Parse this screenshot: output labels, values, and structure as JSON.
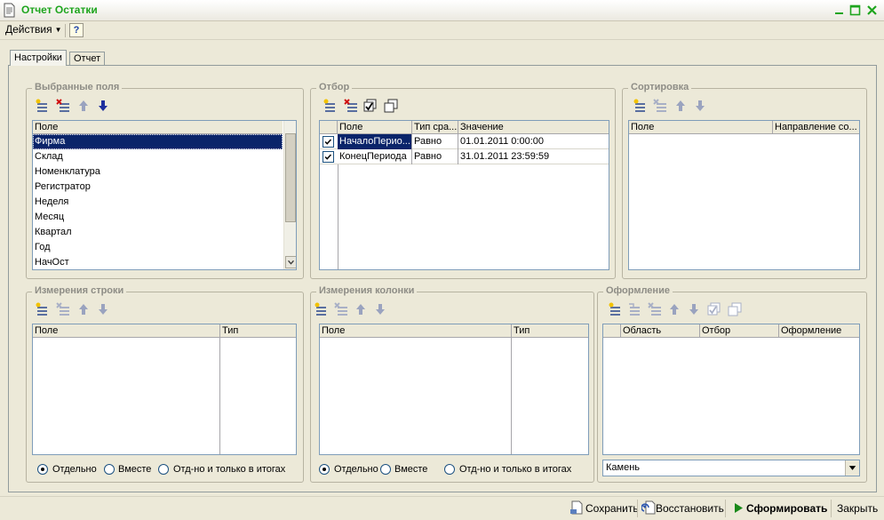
{
  "window": {
    "title": "Отчет  Остатки"
  },
  "menu": {
    "actions_label": "Действия",
    "help_label": "?"
  },
  "tabs": [
    {
      "label": "Настройки"
    },
    {
      "label": "Отчет"
    }
  ],
  "selected_fields": {
    "title": "Выбранные поля",
    "column": "Поле",
    "rows": [
      "Фирма",
      "Склад",
      "Номенклатура",
      "Регистратор",
      "Неделя",
      "Месяц",
      "Квартал",
      "Год",
      "НачОст"
    ],
    "selected_index": 0
  },
  "filter": {
    "title": "Отбор",
    "columns": [
      "Поле",
      "Тип сра...",
      "Значение"
    ],
    "rows": [
      {
        "checked": true,
        "field": "НачалоПерио...",
        "type": "Равно",
        "value": "01.01.2011 0:00:00"
      },
      {
        "checked": true,
        "field": "КонецПериода",
        "type": "Равно",
        "value": "31.01.2011 23:59:59"
      }
    ]
  },
  "sort": {
    "title": "Сортировка",
    "columns": [
      "Поле",
      "Направление со..."
    ]
  },
  "row_dims": {
    "title": "Измерения строки",
    "columns": [
      "Поле",
      "Тип"
    ],
    "options": [
      "Отдельно",
      "Вместе",
      "Отд-но и только в итогах"
    ],
    "selected_option": 0
  },
  "col_dims": {
    "title": "Измерения колонки",
    "columns": [
      "Поле",
      "Тип"
    ],
    "options": [
      "Отдельно",
      "Вместе",
      "Отд-но и только в итогах"
    ],
    "selected_option": 0
  },
  "appearance": {
    "title": "Оформление",
    "columns": [
      "Область",
      "Отбор",
      "Оформление"
    ],
    "style_value": "Камень"
  },
  "footer": {
    "save_label": "Сохранить",
    "restore_label": "Восстановить",
    "generate_label": "Сформировать",
    "close_label": "Закрыть"
  }
}
